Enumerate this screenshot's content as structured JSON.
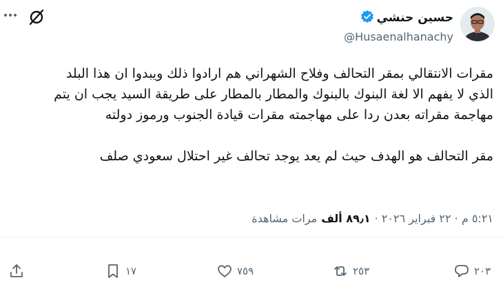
{
  "header": {
    "display_name": "حسين حنشي",
    "handle": "@Husaenalhanachy",
    "verified": true
  },
  "tweet_text": "مقرات الانتقالي بمقر التحالف وفلاح الشهراني هم ارادوا ذلك ويبدوا ان هذا البلد\nالذي لا يفهم الا لغة البنوك بالبنوك والمطار بالمطار على طريقة السيد يجب ان يتم\nمهاجمة مقراته بعدن ردا على مهاجمته مقرات قيادة الجنوب ورموز دولته\n\nمقر التحالف هو الهدف حيث لم يعد يوجد تحالف غير احتلال سعودي صلف",
  "meta": {
    "time_date": "٥:٢١ م · ٢٢ فبراير ٢٠٢٦ ·",
    "views_count": "٨٩٫١ ألف",
    "views_label": "مرات مشاهدة"
  },
  "actions": {
    "replies": "٢٠٣",
    "reposts": "٢٥٣",
    "likes": "٧٥٩",
    "bookmarks": "١٧"
  },
  "colors": {
    "verified": "#1d9bf0",
    "muted": "#536471",
    "text": "#0f1419"
  }
}
